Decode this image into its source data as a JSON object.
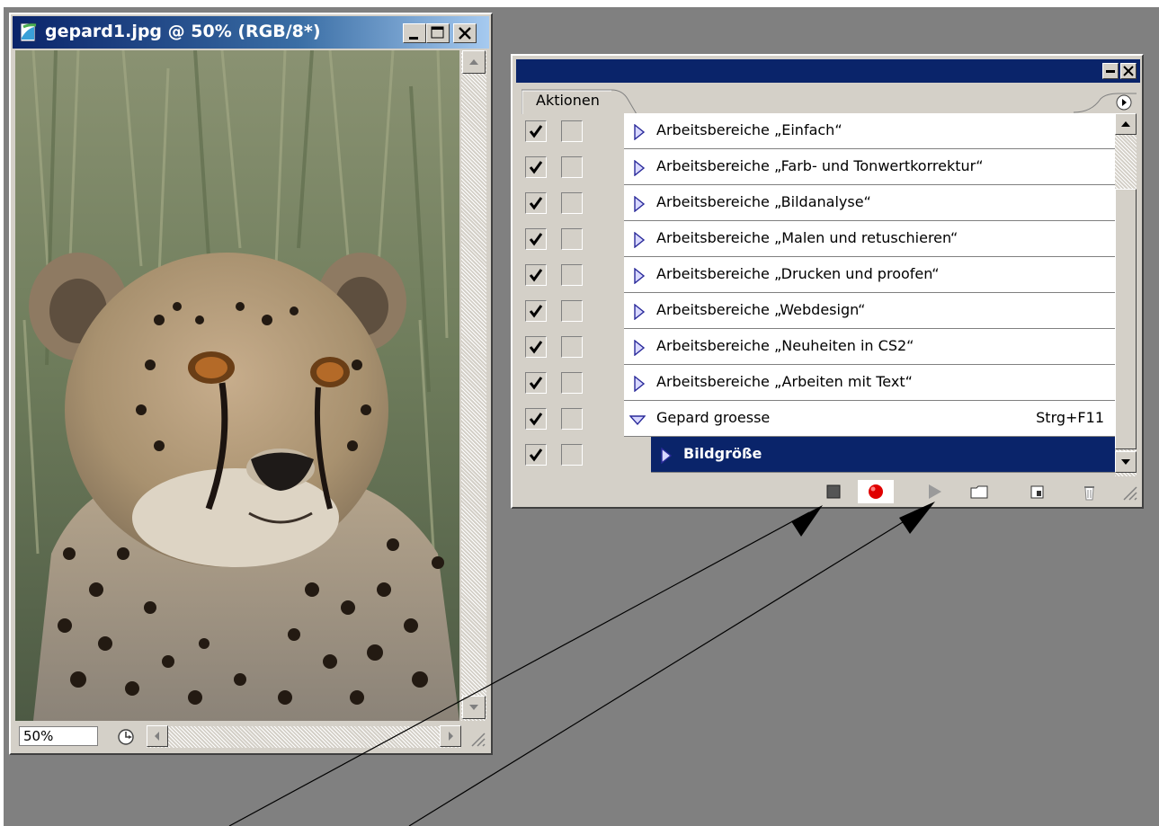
{
  "document": {
    "title": "gepard1.jpg @ 50% (RGB/8*)",
    "zoom": "50%"
  },
  "panel": {
    "tab_label": "Aktionen",
    "rows": [
      {
        "checked": true,
        "expanded": false,
        "label": "Arbeitsbereiche „Einfach“",
        "shortcut": ""
      },
      {
        "checked": true,
        "expanded": false,
        "label": "Arbeitsbereiche „Farb- und Tonwertkorrektur“",
        "shortcut": ""
      },
      {
        "checked": true,
        "expanded": false,
        "label": "Arbeitsbereiche „Bildanalyse“",
        "shortcut": ""
      },
      {
        "checked": true,
        "expanded": false,
        "label": "Arbeitsbereiche „Malen und retuschieren“",
        "shortcut": ""
      },
      {
        "checked": true,
        "expanded": false,
        "label": "Arbeitsbereiche „Drucken und proofen“",
        "shortcut": ""
      },
      {
        "checked": true,
        "expanded": false,
        "label": "Arbeitsbereiche „Webdesign“",
        "shortcut": ""
      },
      {
        "checked": true,
        "expanded": false,
        "label": "Arbeitsbereiche „Neuheiten in CS2“",
        "shortcut": ""
      },
      {
        "checked": true,
        "expanded": false,
        "label": "Arbeitsbereiche „Arbeiten mit Text“",
        "shortcut": ""
      },
      {
        "checked": true,
        "expanded": true,
        "label": "Gepard groesse",
        "shortcut": "Strg+F11"
      },
      {
        "checked": true,
        "expanded": false,
        "label": "Bildgröße",
        "shortcut": "",
        "selected": true,
        "child": true
      }
    ],
    "toolbar": [
      "stop-icon",
      "record-icon",
      "play-icon",
      "new-set-icon",
      "new-action-icon",
      "trash-icon"
    ]
  },
  "colors": {
    "desktop": "#808080",
    "title_bar": "#0a246a",
    "record": "#e00000"
  }
}
